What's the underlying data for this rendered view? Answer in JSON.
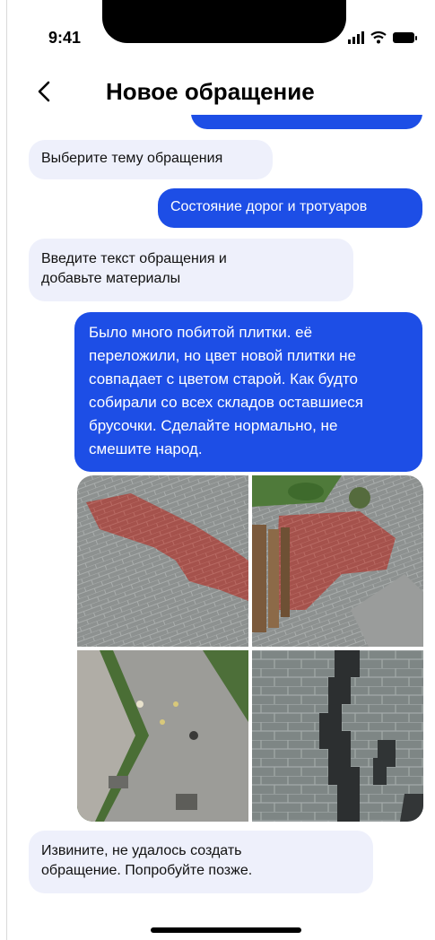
{
  "status_bar": {
    "time": "9:41"
  },
  "header": {
    "title": "Новое обращение"
  },
  "messages": {
    "partial_top": "Выберите тему обращения",
    "bot_topic_prompt": "Выберите тему обращения",
    "user_topic": "Состояние дорог и тротуаров",
    "bot_text_prompt_line1": "Введите текст обращения и",
    "bot_text_prompt_line2": "добавьте материалы",
    "user_text_lines": [
      "Было много побитой плитки. её",
      "переложили, но цвет новой плитки не",
      "совпадает с цветом старой. Как будто",
      "собирали со всех складов оставшиеся",
      "брусочки. Сделайте нормально, не",
      "смешите народ."
    ],
    "bot_error_line1": "Извините, не удалось создать",
    "bot_error_line2": "обращение. Попробуйте позже."
  },
  "colors": {
    "accent": "#1d4ee6",
    "incoming_bg": "#eef0fb"
  },
  "icons": [
    "back-chevron-icon",
    "signal-icon",
    "wifi-icon",
    "battery-icon"
  ]
}
